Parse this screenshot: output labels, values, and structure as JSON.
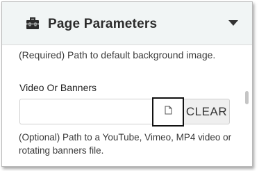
{
  "panel": {
    "title": "Page Parameters",
    "header_icon": "toolbox-icon",
    "collapse_icon": "caret-down-icon"
  },
  "background_field": {
    "help": "(Required) Path to default background image."
  },
  "video_field": {
    "label": "Video Or Banners",
    "value": "",
    "browse_icon": "file-icon",
    "clear_label": "CLEAR",
    "help": "(Optional) Path to a YouTube, Vimeo, MP4 video or rotating banners file."
  },
  "colors": {
    "header_bg": "#f1f5f5",
    "text": "#2b2b2b",
    "clear_bg": "#efefef",
    "focus_border": "#111111"
  }
}
